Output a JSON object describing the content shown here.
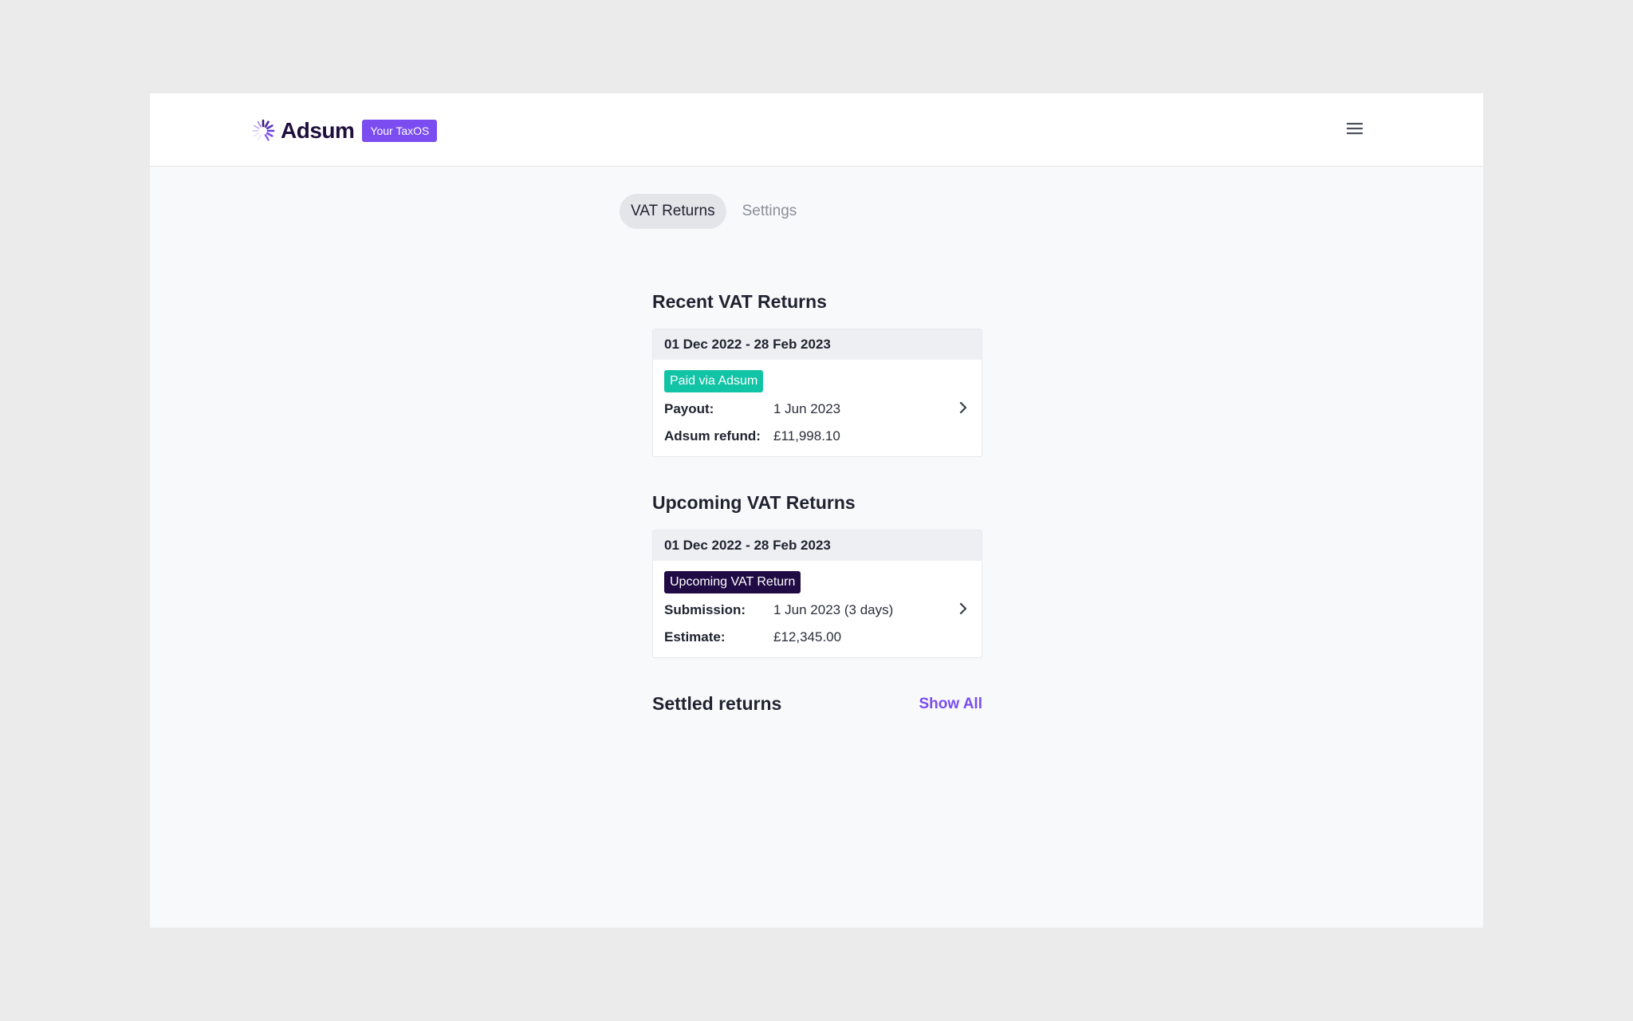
{
  "brand": {
    "name": "Adsum",
    "badge": "Your TaxOS",
    "accent_color": "#7b4cf0",
    "logo_icon": "sunburst-logo-icon"
  },
  "header": {
    "menu_icon": "hamburger-menu-icon"
  },
  "tabs": [
    {
      "label": "VAT Returns",
      "active": true
    },
    {
      "label": "Settings",
      "active": false
    }
  ],
  "recent": {
    "title": "Recent VAT Returns",
    "card": {
      "period": "01 Dec 2022 - 28 Feb 2023",
      "status": "Paid via Adsum",
      "status_color": "#12c4a6",
      "rows": [
        {
          "label": "Payout:",
          "value": "1 Jun 2023"
        },
        {
          "label": "Adsum refund:",
          "value": "£11,998.10"
        }
      ]
    }
  },
  "upcoming": {
    "title": "Upcoming VAT Returns",
    "card": {
      "period": "01 Dec 2022 - 28 Feb 2023",
      "status": "Upcoming VAT Return",
      "status_color": "#200b44",
      "rows": [
        {
          "label": "Submission:",
          "value": "1 Jun 2023 (3 days)"
        },
        {
          "label": "Estimate:",
          "value": "£12,345.00"
        }
      ]
    }
  },
  "settled": {
    "title": "Settled returns",
    "show_all": "Show All"
  }
}
